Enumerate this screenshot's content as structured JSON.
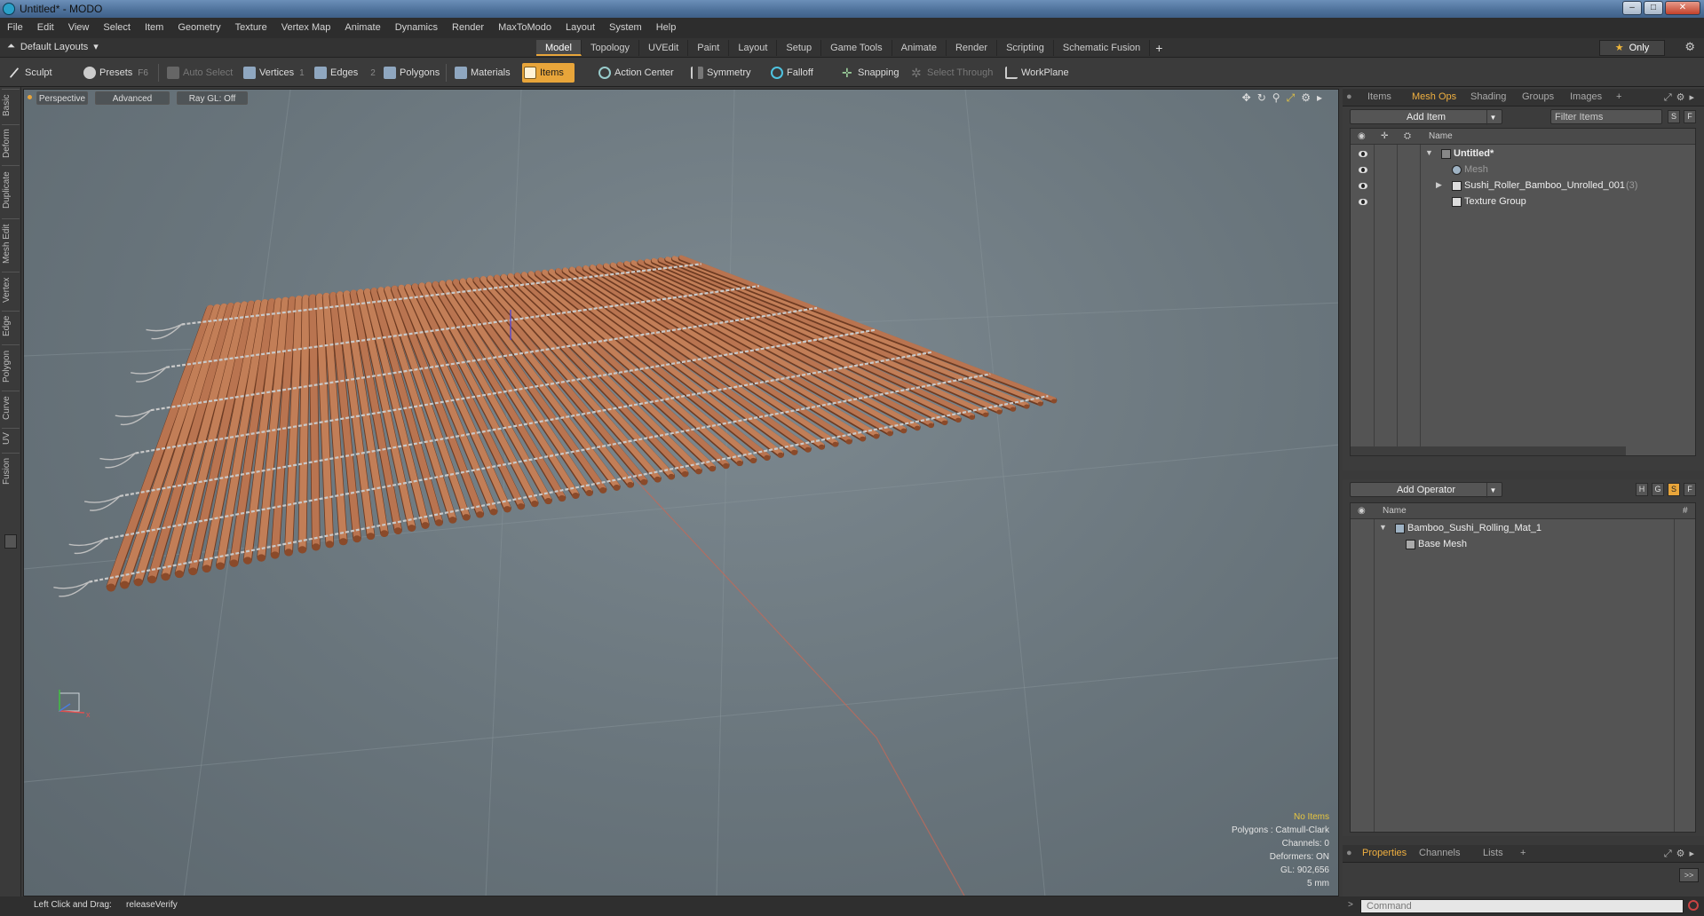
{
  "window": {
    "title": "Untitled* - MODO"
  },
  "menu": [
    "File",
    "Edit",
    "View",
    "Select",
    "Item",
    "Geometry",
    "Texture",
    "Vertex Map",
    "Animate",
    "Dynamics",
    "Render",
    "MaxToModo",
    "Layout",
    "System",
    "Help"
  ],
  "layout": {
    "dropdown": "Default Layouts",
    "tabs": [
      "Model",
      "Topology",
      "UVEdit",
      "Paint",
      "Layout",
      "Setup",
      "Game Tools",
      "Animate",
      "Render",
      "Scripting",
      "Schematic Fusion"
    ],
    "active_tab": "Model",
    "only": "Only"
  },
  "toolbar": {
    "sculpt": "Sculpt",
    "presets": "Presets",
    "presets_key": "F6",
    "auto_select": "Auto Select",
    "vertices": "Vertices",
    "vertices_key": "1",
    "edges": "Edges",
    "edges_key": "2",
    "polygons": "Polygons",
    "materials": "Materials",
    "items": "Items",
    "action_center": "Action Center",
    "symmetry": "Symmetry",
    "falloff": "Falloff",
    "snapping": "Snapping",
    "select_through": "Select Through",
    "workplane": "WorkPlane"
  },
  "left_tabs": [
    "Basic",
    "Deform",
    "Duplicate",
    "Mesh Edit",
    "Vertex",
    "Edge",
    "Polygon",
    "Curve",
    "UV",
    "Fusion"
  ],
  "viewport": {
    "view": "Perspective",
    "advanced": "Advanced",
    "raygl": "Ray GL: Off",
    "stats": {
      "items": "No Items",
      "polygons": "Polygons : Catmull-Clark",
      "channels": "Channels: 0",
      "deformers": "Deformers: ON",
      "gl": "GL: 902,656",
      "scale": "5 mm"
    }
  },
  "status": {
    "label": "Left Click and Drag:",
    "value": "releaseVerify"
  },
  "items_panel": {
    "tabs": [
      "Items",
      "Mesh Ops",
      "Shading",
      "Groups",
      "Images"
    ],
    "active_tab": "Mesh Ops",
    "add_item": "Add Item",
    "filter": "Filter Items",
    "s_btn": "S",
    "f_btn": "F",
    "col_name": "Name",
    "rows": [
      {
        "name": "Untitled*",
        "count": ""
      },
      {
        "name": "Mesh",
        "count": ""
      },
      {
        "name": "Sushi_Roller_Bamboo_Unrolled_001",
        "count": "(3)"
      },
      {
        "name": "Texture Group",
        "count": ""
      }
    ]
  },
  "operator_panel": {
    "add_operator": "Add Operator",
    "btns": [
      "H",
      "G",
      "S",
      "F"
    ],
    "col_name": "Name",
    "col_hash": "#",
    "rows": [
      {
        "name": "Bamboo_Sushi_Rolling_Mat_1"
      },
      {
        "name": "Base Mesh"
      }
    ]
  },
  "properties_panel": {
    "tabs": [
      "Properties",
      "Channels",
      "Lists"
    ],
    "active_tab": "Properties",
    "expand": ">>"
  },
  "command": {
    "placeholder": "Command"
  },
  "colors": {
    "accent": "#e8a53a",
    "bamboo": "#b8714a",
    "viewport": "#6c787f"
  }
}
